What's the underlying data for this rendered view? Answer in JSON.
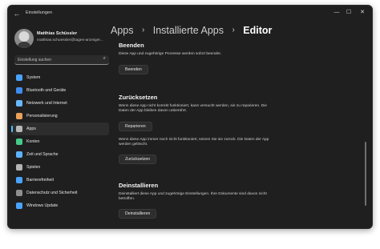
{
  "window": {
    "title": "Einstellungen"
  },
  "user": {
    "name": "Matthias Schüssler",
    "email": "matthias.schuessler@tages-anzeiger..."
  },
  "search": {
    "placeholder": "Einstellung suchen"
  },
  "nav": [
    {
      "label": "System",
      "icon": "monitor-icon",
      "color": "#4aa3ff"
    },
    {
      "label": "Bluetooth und Geräte",
      "icon": "bluetooth-icon",
      "color": "#3f8cf0"
    },
    {
      "label": "Netzwerk und Internet",
      "icon": "wifi-icon",
      "color": "#6ab7ff"
    },
    {
      "label": "Personalisierung",
      "icon": "brush-icon",
      "color": "#e9a15b"
    },
    {
      "label": "Apps",
      "icon": "apps-icon",
      "color": "#b7b7b7",
      "active": true
    },
    {
      "label": "Konten",
      "icon": "person-icon",
      "color": "#47c98a"
    },
    {
      "label": "Zeit und Sprache",
      "icon": "globe-clock-icon",
      "color": "#5db2ff"
    },
    {
      "label": "Spielen",
      "icon": "gamepad-icon",
      "color": "#b4b4b4"
    },
    {
      "label": "Barrierefreiheit",
      "icon": "accessibility-icon",
      "color": "#4aa3ff"
    },
    {
      "label": "Datenschutz und Sicherheit",
      "icon": "shield-icon",
      "color": "#8e8e8e"
    },
    {
      "label": "Windows Update",
      "icon": "update-icon",
      "color": "#4aa3ff"
    }
  ],
  "breadcrumb": {
    "item1": "Apps",
    "item2": "Installierte Apps",
    "current": "Editor"
  },
  "beenden": {
    "title": "Beenden",
    "desc": "Diese App und zugehörige Prozesse werden sofort beendet.",
    "button": "Beenden"
  },
  "reset": {
    "title": "Zurücksetzen",
    "desc1": "Wenn diese App nicht korrekt funktioniert, kann versucht werden, sie zu reparieren. Die Daten der App bleiben davon unberührt.",
    "repair_button": "Reparieren",
    "desc2": "Wenn diese App immer noch nicht funktioniert, setzen Sie sie zurück. Die Daten der App werden gelöscht.",
    "reset_button": "Zurücksetzen"
  },
  "uninstall": {
    "title": "Deinstallieren",
    "desc": "Deinstalliert diese App und zugehörige Einstellungen. Ihre Dokumente sind davon nicht betroffen.",
    "button": "Deinstallieren"
  },
  "accent_color": "#4cc2ff"
}
